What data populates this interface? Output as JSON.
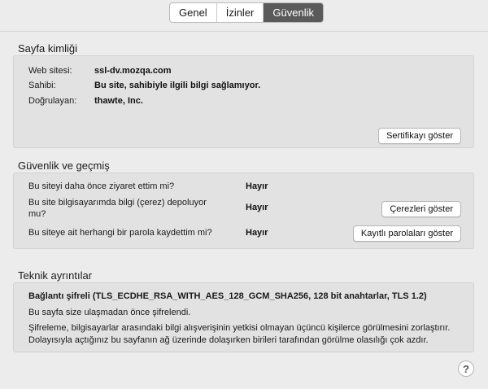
{
  "tabs": [
    {
      "label": "Genel"
    },
    {
      "label": "İzinler"
    },
    {
      "label": "Güvenlik"
    }
  ],
  "identity": {
    "title": "Sayfa kimliği",
    "website_label": "Web sitesi:",
    "website_value": "ssl-dv.mozqa.com",
    "owner_label": "Sahibi:",
    "owner_value": "Bu site, sahibiyle ilgili bilgi sağlamıyor.",
    "verifier_label": "Doğrulayan:",
    "verifier_value": "thawte, Inc.",
    "cert_button": "Sertifikayı göster"
  },
  "privacy": {
    "title": "Güvenlik ve geçmiş",
    "q1": "Bu siteyi daha önce ziyaret ettim mi?",
    "a1": "Hayır",
    "q2": "Bu site bilgisayarımda bilgi (çerez) depoluyor mu?",
    "a2": "Hayır",
    "cookies_button": "Çerezleri göster",
    "q3": "Bu siteye ait herhangi bir parola kaydettim mi?",
    "a3": "Hayır",
    "passwords_button": "Kayıtlı parolaları göster"
  },
  "technical": {
    "title": "Teknik ayrıntılar",
    "cipher": "Bağlantı şifreli (TLS_ECDHE_RSA_WITH_AES_128_GCM_SHA256, 128 bit anahtarlar, TLS 1.2)",
    "line1": "Bu sayfa size ulaşmadan önce şifrelendi.",
    "line2": "Şifreleme, bilgisayarlar arasındaki bilgi alışverişinin yetkisi olmayan üçüncü kişilerce görülmesini zorlaştırır. Dolayısıyla açtığınız bu sayfanın ağ üzerinde dolaşırken birileri tarafından görülme olasılığı çok azdır."
  },
  "help": {
    "label": "?"
  }
}
